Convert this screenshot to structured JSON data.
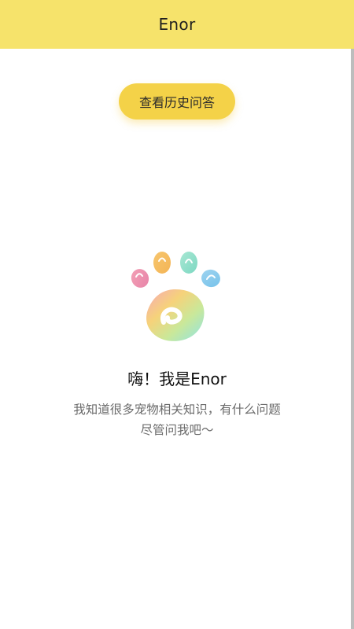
{
  "header": {
    "title": "Enor",
    "background_color": "#f6e36b"
  },
  "history_button": {
    "label": "查看历史问答",
    "background_color": "#f4d248"
  },
  "mascot": {
    "icon": "paw-logo-icon"
  },
  "welcome": {
    "greeting": "嗨！我是Enor",
    "intro_line1": "我知道很多宠物相关知识，有什么问题",
    "intro_line2": "尽管问我吧～"
  }
}
